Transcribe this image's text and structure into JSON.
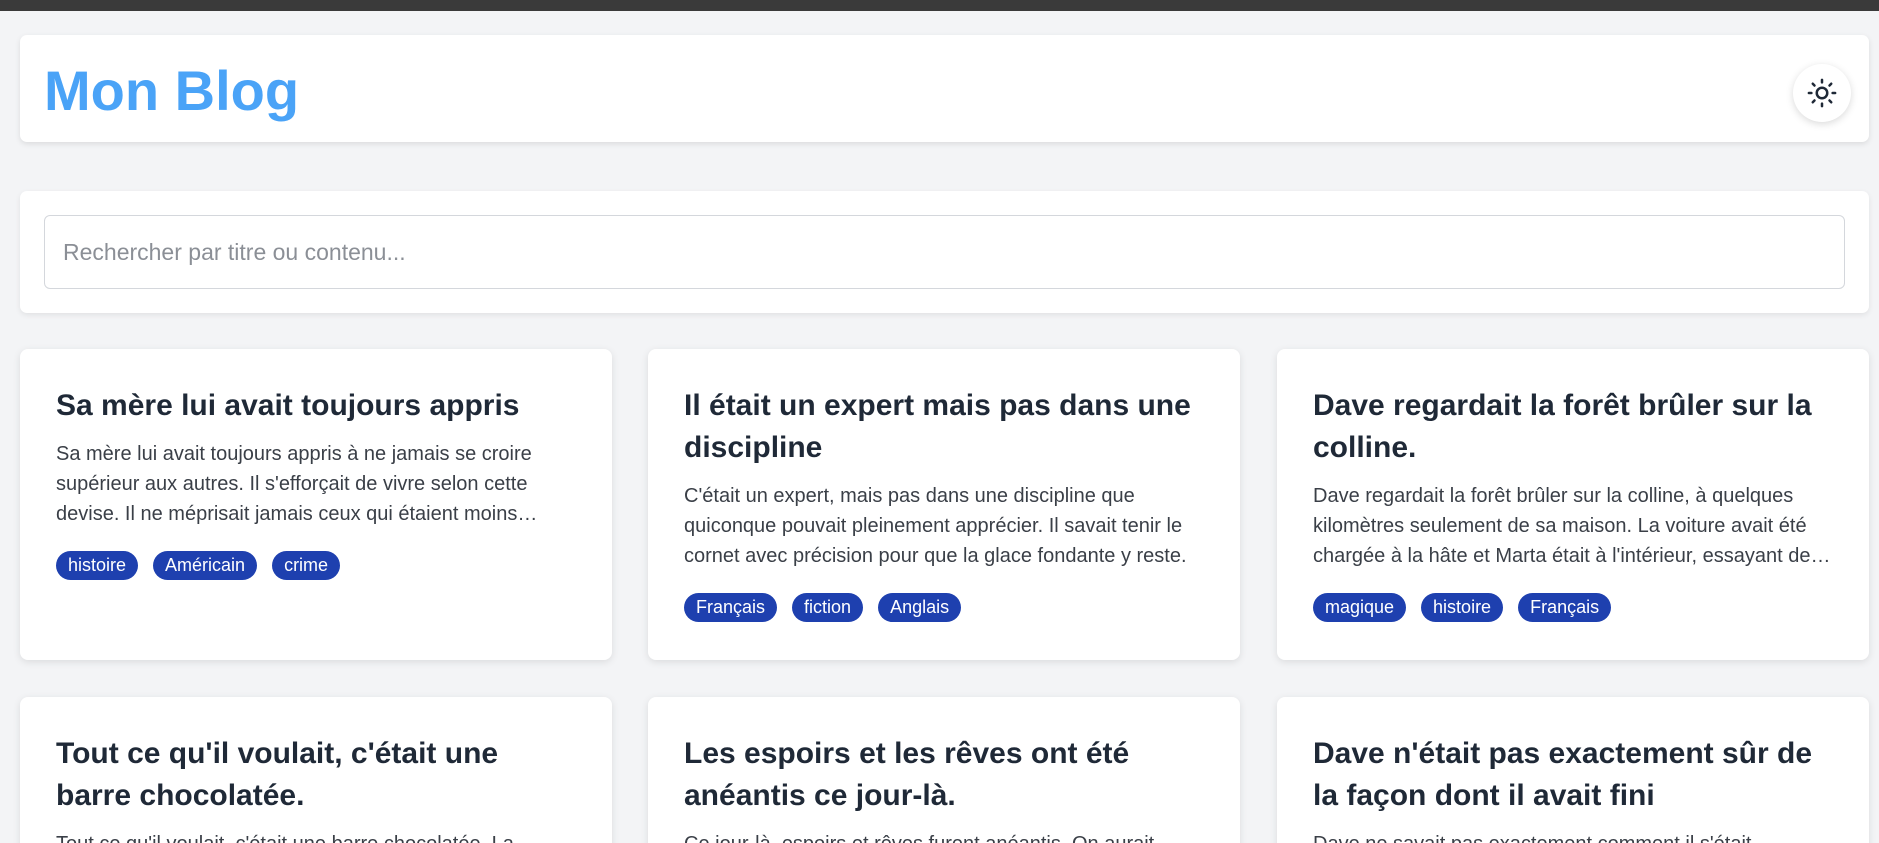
{
  "header": {
    "title": "Mon Blog",
    "theme_toggle_icon": "sun-icon"
  },
  "search": {
    "placeholder": "Rechercher par titre ou contenu..."
  },
  "colors": {
    "title_accent": "#4aa3f7",
    "tag_background": "#1e40af",
    "page_background": "#f3f4f6"
  },
  "posts": [
    {
      "title": "Sa mère lui avait toujours appris",
      "excerpt": "Sa mère lui avait toujours appris à ne jamais se croire supérieur aux autres. Il s'efforçait de vivre selon cette devise. Il ne méprisait jamais ceux qui étaient moins chanceux.",
      "tags": [
        "histoire",
        "Américain",
        "crime"
      ]
    },
    {
      "title": "Il était un expert mais pas dans une discipline",
      "excerpt": "C'était un expert, mais pas dans une discipline que quiconque pouvait pleinement apprécier. Il savait tenir le cornet avec précision pour que la glace fondante y reste.",
      "tags": [
        "Français",
        "fiction",
        "Anglais"
      ]
    },
    {
      "title": "Dave regardait la forêt brûler sur la colline.",
      "excerpt": "Dave regardait la forêt brûler sur la colline, à quelques kilomètres seulement de sa maison. La voiture avait été chargée à la hâte et Marta était à l'intérieur, essayant de rassembler.",
      "tags": [
        "magique",
        "histoire",
        "Français"
      ]
    },
    {
      "title": "Tout ce qu'il voulait, c'était une barre chocolatée.",
      "excerpt": "Tout ce qu'il voulait, c'était une barre chocolatée. La",
      "tags": []
    },
    {
      "title": "Les espoirs et les rêves ont été anéantis ce jour-là.",
      "excerpt": "Ce jour-là, espoirs et rêves furent anéantis. On aurait",
      "tags": []
    },
    {
      "title": "Dave n'était pas exactement sûr de la façon dont il avait fini",
      "excerpt": "Dave ne savait pas exactement comment il s'était",
      "tags": []
    }
  ]
}
